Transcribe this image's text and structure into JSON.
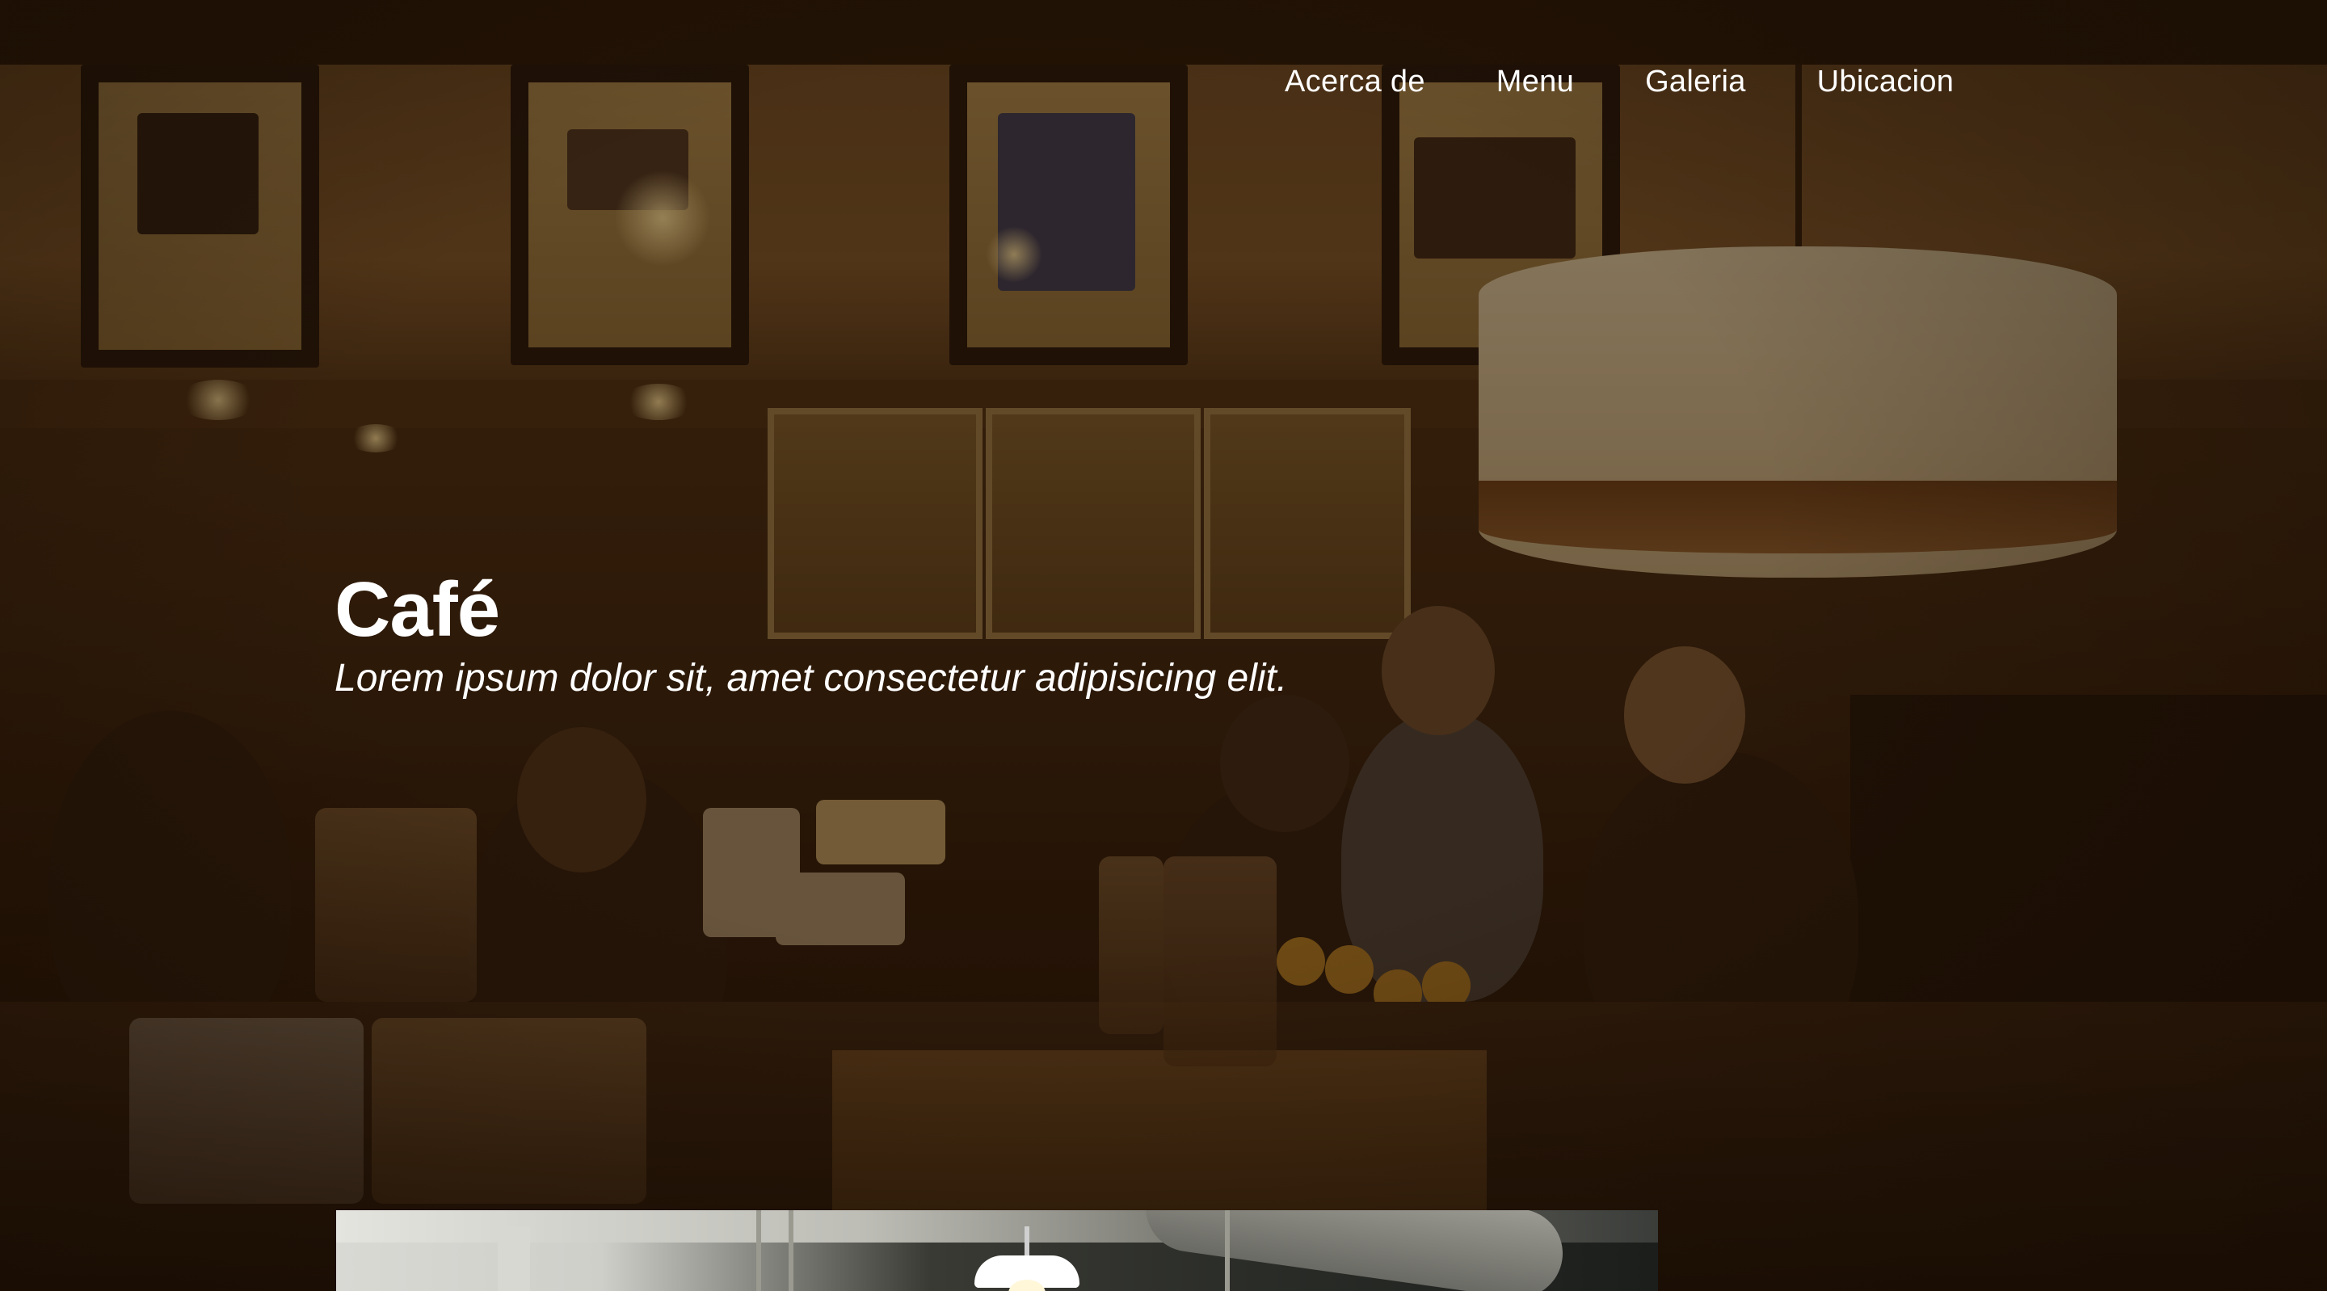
{
  "nav": {
    "items": [
      {
        "label": "Acerca de"
      },
      {
        "label": "Menu"
      },
      {
        "label": "Galeria"
      },
      {
        "label": "Ubicacion"
      }
    ]
  },
  "hero": {
    "title": "Café",
    "subtitle": "Lorem ipsum dolor sit, amet consectetur adipisicing elit."
  },
  "colors": {
    "text": "#ffffff",
    "overlay": "#1e1004"
  }
}
